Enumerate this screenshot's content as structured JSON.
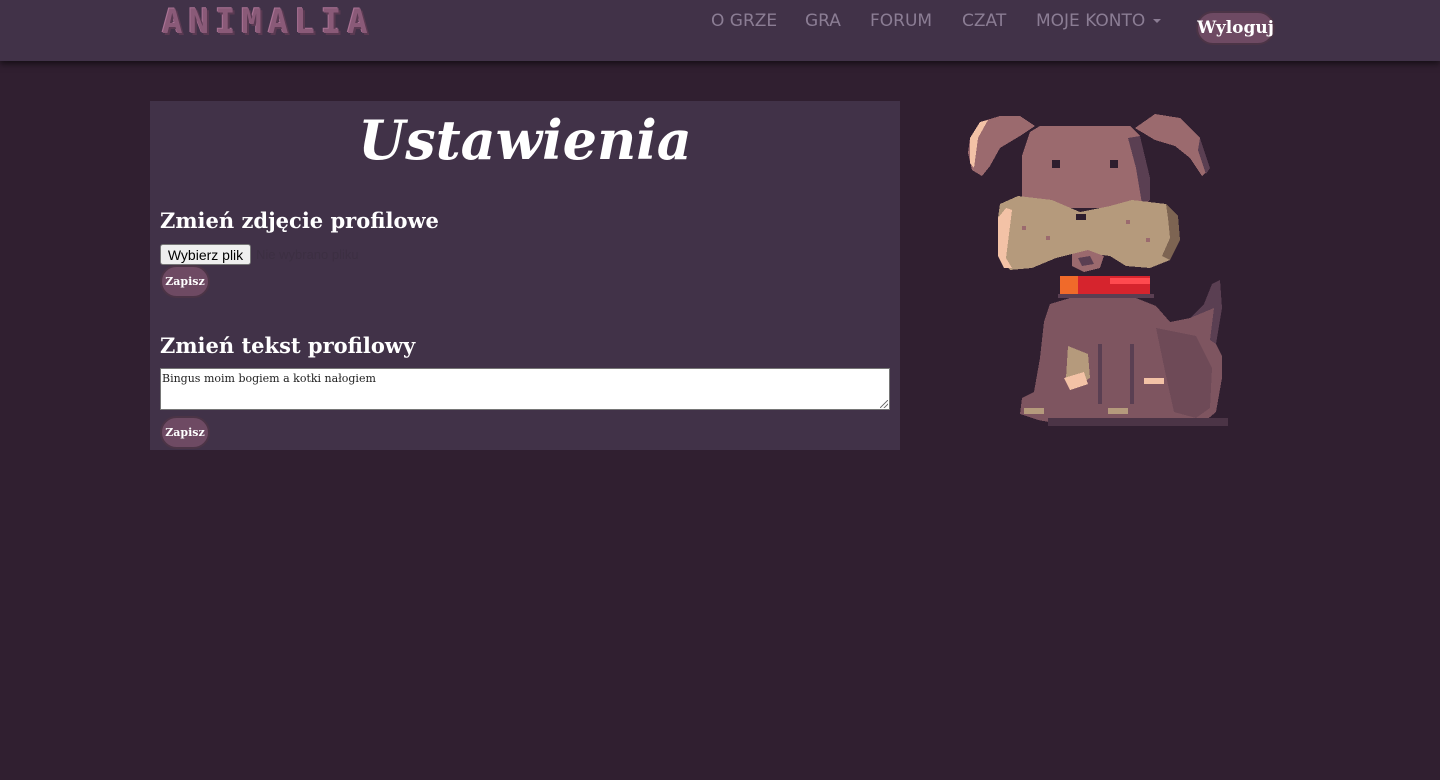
{
  "brand": {
    "logo_text": "ANIMALIA"
  },
  "nav": {
    "items": [
      "O GRZE",
      "GRA",
      "FORUM",
      "CZAT"
    ],
    "account_label": "MOJE KONTO",
    "logout_label": "Wyloguj"
  },
  "settings": {
    "title": "Ustawienia",
    "photo_section": {
      "heading": "Zmień zdjęcie profilowe",
      "file_button_label": "Wybierz plik",
      "file_status": "Nie wybrano pliku",
      "save_label": "Zapisz"
    },
    "text_section": {
      "heading": "Zmień tekst profilowy",
      "text_value": "Bingus moim bogiem a kotki nałogiem",
      "save_label": "Zapisz"
    }
  },
  "colors": {
    "background": "#301f30",
    "panel": "#413248",
    "button": "#6e4a63",
    "nav_text": "#8b7d94"
  },
  "icons": {
    "mascot": "pixel-dog-icon",
    "dropdown": "caret-down-icon"
  }
}
